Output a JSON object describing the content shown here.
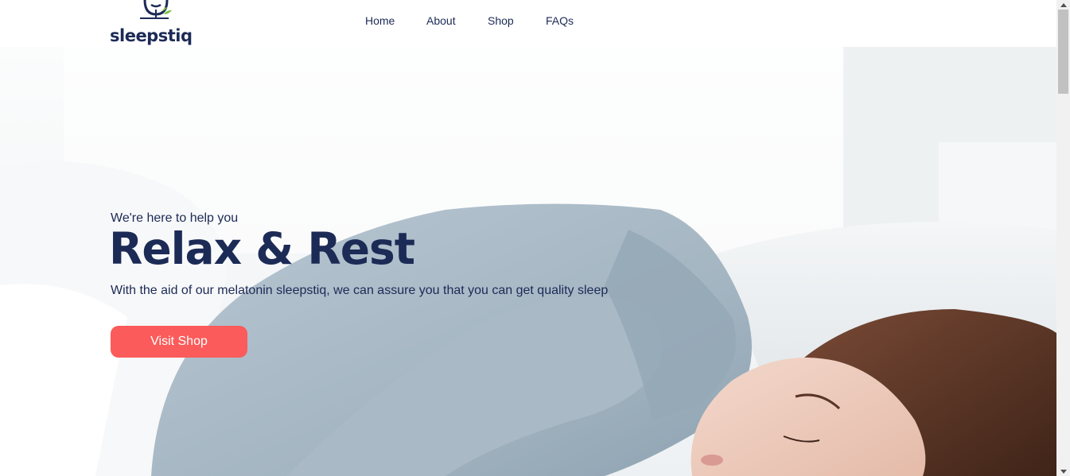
{
  "brand": {
    "name": "sleepstiq",
    "logo_icon": "bird-icon"
  },
  "nav": {
    "items": [
      {
        "label": "Home"
      },
      {
        "label": "About"
      },
      {
        "label": "Shop"
      },
      {
        "label": "FAQs"
      }
    ]
  },
  "hero": {
    "subtitle": "We're here to help you",
    "headline": "Relax & Rest",
    "description": "With the aid of our melatonin sleepstiq, we can assure you that you can get quality sleep",
    "cta_label": "Visit Shop",
    "background_image": "woman-sleeping-photo"
  },
  "colors": {
    "brand_navy": "#1c2a56",
    "accent_coral": "#fb5b5a",
    "leaf_green": "#7bc043"
  },
  "scrollbar": {
    "up_icon": "scroll-up-arrow-icon",
    "down_icon": "scroll-down-arrow-icon"
  }
}
